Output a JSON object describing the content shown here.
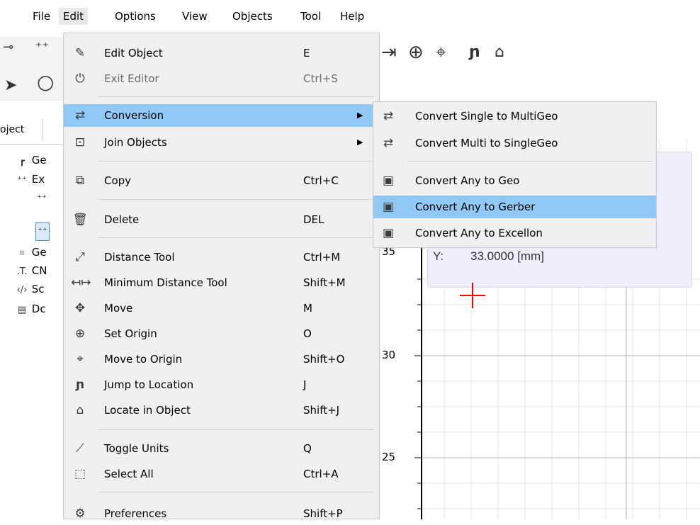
{
  "menubar": {
    "items": [
      "File",
      "Edit",
      "Options",
      "View",
      "Objects",
      "Tool",
      "Help"
    ]
  },
  "left_panel": {
    "tab_label": "oject",
    "tree": [
      {
        "icon": "geometry-icon",
        "label": "Ge"
      },
      {
        "icon": "excellon-icon",
        "label": "Ex"
      },
      {
        "icon": "excellon-child-icon",
        "label": ""
      },
      {
        "icon": "excellon-child-selected-icon",
        "label": ""
      },
      {
        "icon": "geo-group-icon",
        "label": "Ge"
      },
      {
        "icon": "cnc-icon",
        "label": "CN"
      },
      {
        "icon": "script-icon",
        "label": "Sc"
      },
      {
        "icon": "document-icon",
        "label": "Dc"
      }
    ]
  },
  "edit_menu": {
    "items": [
      {
        "label": "Edit Object",
        "shortcut": "E",
        "icon": "edit-object-icon",
        "enabled": true
      },
      {
        "label": "Exit Editor",
        "shortcut": "Ctrl+S",
        "icon": "power-icon",
        "enabled": false
      },
      {
        "label": "Conversion",
        "shortcut": "",
        "icon": "conversion-arrows-icon",
        "enabled": true,
        "submenu": true,
        "highlighted": true
      },
      {
        "label": "Join Objects",
        "shortcut": "",
        "icon": "join-icon",
        "enabled": true,
        "submenu": true
      },
      {
        "label": "Copy",
        "shortcut": "Ctrl+C",
        "icon": "copy-icon",
        "enabled": true
      },
      {
        "label": "Delete",
        "shortcut": "DEL",
        "icon": "trash-icon",
        "enabled": true
      },
      {
        "label": "Distance Tool",
        "shortcut": "Ctrl+M",
        "icon": "distance-icon",
        "enabled": true
      },
      {
        "label": "Minimum Distance Tool",
        "shortcut": "Shift+M",
        "icon": "min-distance-icon",
        "enabled": true
      },
      {
        "label": "Move",
        "shortcut": "M",
        "icon": "move-icon",
        "enabled": true
      },
      {
        "label": "Set Origin",
        "shortcut": "O",
        "icon": "set-origin-icon",
        "enabled": true
      },
      {
        "label": "Move to Origin",
        "shortcut": "Shift+O",
        "icon": "move-origin-icon",
        "enabled": true
      },
      {
        "label": "Jump to Location",
        "shortcut": "J",
        "icon": "jump-icon",
        "enabled": true
      },
      {
        "label": "Locate in Object",
        "shortcut": "Shift+J",
        "icon": "locate-icon",
        "enabled": true
      },
      {
        "label": "Toggle Units",
        "shortcut": "Q",
        "icon": "ruler-icon",
        "enabled": true
      },
      {
        "label": "Select All",
        "shortcut": "Ctrl+A",
        "icon": "select-all-icon",
        "enabled": true
      },
      {
        "label": "Preferences",
        "shortcut": "Shift+P",
        "icon": "gear-icon",
        "enabled": true
      }
    ]
  },
  "conversion_submenu": {
    "items": [
      {
        "label": "Convert Single to MultiGeo",
        "icon": "conversion-arrows-icon"
      },
      {
        "label": "Convert Multi to SingleGeo",
        "icon": "conversion-arrows-icon"
      },
      {
        "label": "Convert Any to Geo",
        "icon": "convert-any-icon"
      },
      {
        "label": "Convert Any to Gerber",
        "icon": "convert-any-icon",
        "highlighted": true
      },
      {
        "label": "Convert Any to Excellon",
        "icon": "convert-any-icon"
      }
    ]
  },
  "canvas": {
    "coords_y_label": "Y:",
    "coords_y_value": "33.0000 [mm]",
    "axis_ticks": [
      "35",
      "30",
      "25"
    ],
    "colors": {
      "cursor": "#ff0000",
      "grid": "#e4e4e4",
      "highlight": "#90c8f6",
      "coord_box": "#eeeefc"
    }
  }
}
